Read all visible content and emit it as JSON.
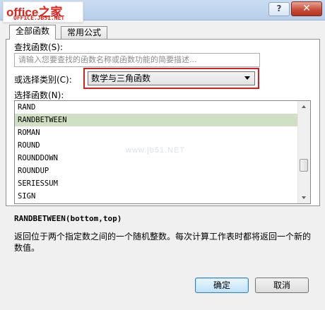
{
  "titlebar": {
    "logo_text": "office之家",
    "logo_sub": "OFFICE.JB51.NET",
    "help_label": "?",
    "close_label": "✕"
  },
  "tabs": [
    {
      "label": "全部函数",
      "active": true
    },
    {
      "label": "常用公式",
      "active": false
    }
  ],
  "search": {
    "label": "查找函数(S):",
    "placeholder": "请输入您要查找的函数名称或函数功能的简要描述..."
  },
  "category": {
    "label": "或选择类别(C):",
    "value": "数学与三角函数"
  },
  "functions": {
    "label": "选择函数(N):",
    "items": [
      "RAND",
      "RANDBETWEEN",
      "ROMAN",
      "ROUND",
      "ROUNDDOWN",
      "ROUNDUP",
      "SERIESSUM",
      "SIGN"
    ],
    "selected_index": 1
  },
  "watermark": "www.jb51.NET",
  "signature": "RANDBETWEEN(bottom,top)",
  "description": "返回位于两个指定数之间的一个随机整数。每次计算工作表时都将返回一个新的数值。",
  "buttons": {
    "ok": "确定",
    "cancel": "取消"
  }
}
